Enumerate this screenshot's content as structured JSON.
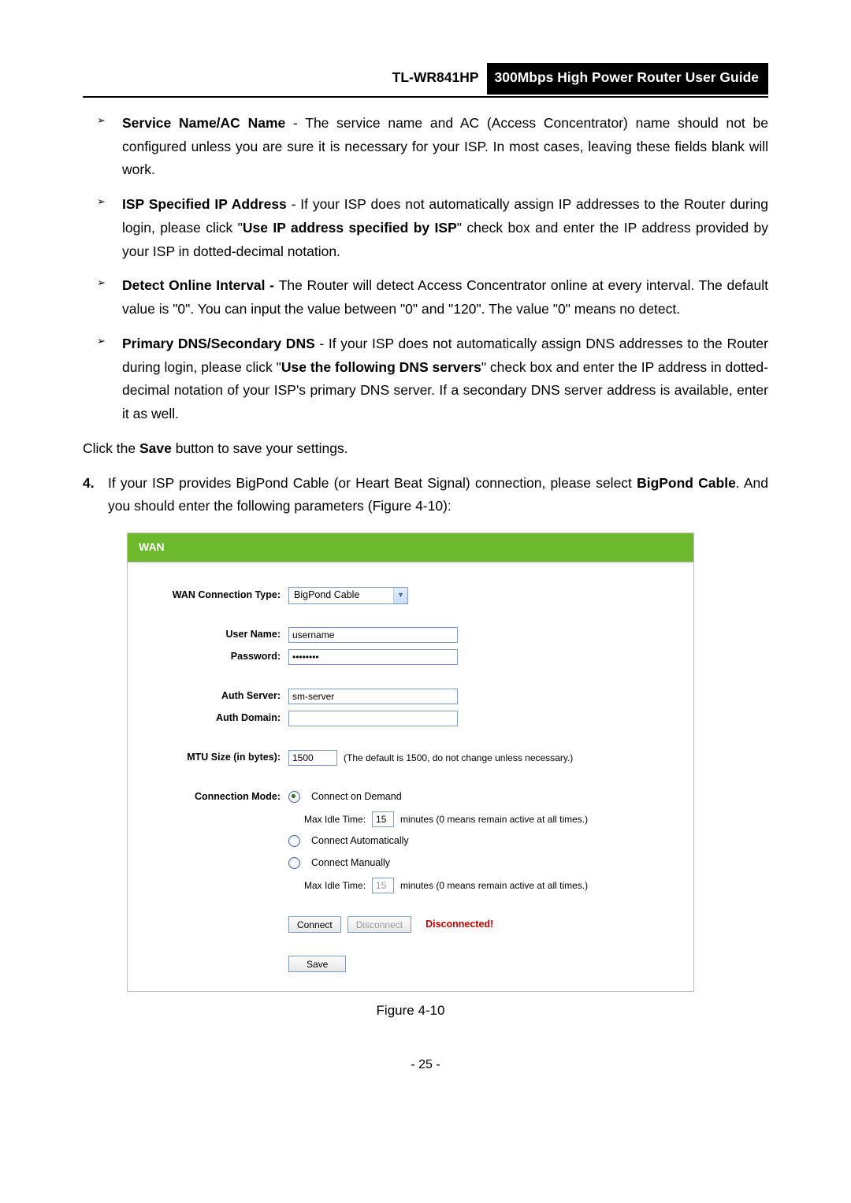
{
  "header": {
    "model": "TL-WR841HP",
    "guide": "300Mbps High Power Router User Guide"
  },
  "bullets": [
    {
      "heading": "Service Name/AC Name",
      "tail": " - The service name and AC (Access Concentrator) name should not be configured unless you are sure it is necessary for your ISP. In most cases, leaving these fields blank will work."
    },
    {
      "heading": "ISP Specified IP Address",
      "dash": " - If your ISP does not automatically assign IP addresses to the Router during login, please click \"",
      "bold2": "Use IP address specified by ISP",
      "tail": "\" check box and enter the IP address provided by your ISP in dotted-decimal notation."
    },
    {
      "heading": "Detect Online Interval - ",
      "tail": "The Router will detect Access Concentrator online at every interval. The default value is \"0\". You can input the value between \"0\" and \"120\". The value \"0\" means no detect."
    },
    {
      "heading": "Primary DNS/Secondary DNS",
      "dash": " - If your ISP does not automatically assign DNS addresses to the Router during login, please click \"",
      "bold2": "Use the following DNS servers",
      "tail": "\" check box and enter the IP address in dotted-decimal notation of your ISP's primary DNS server. If a secondary DNS server address is available, enter it as well."
    }
  ],
  "save_para": {
    "t1": "Click the ",
    "b1": "Save",
    "t2": " button to save your settings."
  },
  "numbered": {
    "num": "4.",
    "t1": "If your ISP provides BigPond Cable (or Heart Beat Signal) connection, please select ",
    "b1": "BigPond Cable",
    "t2": ". And you should enter the following parameters (Figure 4-10):"
  },
  "fig": {
    "title": "WAN",
    "labels": {
      "conn_type": "WAN Connection Type:",
      "user": "User Name:",
      "pass": "Password:",
      "auth_server": "Auth Server:",
      "auth_domain": "Auth Domain:",
      "mtu": "MTU Size (in bytes):",
      "mode": "Connection Mode:"
    },
    "conn_type_value": "BigPond Cable",
    "user_value": "username",
    "pass_value": "••••••••",
    "auth_server_value": "sm-server",
    "auth_domain_value": "",
    "mtu_value": "1500",
    "mtu_note": "(The default is 1500, do not change unless necessary.)",
    "modes": {
      "on_demand": "Connect on Demand",
      "max_idle": "Max Idle Time:",
      "idle1": "15",
      "minutes_note": "minutes (0 means remain active at all times.)",
      "auto": "Connect Automatically",
      "manual": "Connect Manually",
      "idle2": "15"
    },
    "buttons": {
      "connect": "Connect",
      "disconnect": "Disconnect",
      "save": "Save"
    },
    "status": "Disconnected!"
  },
  "caption": "Figure 4-10",
  "pagenum": "- 25 -"
}
